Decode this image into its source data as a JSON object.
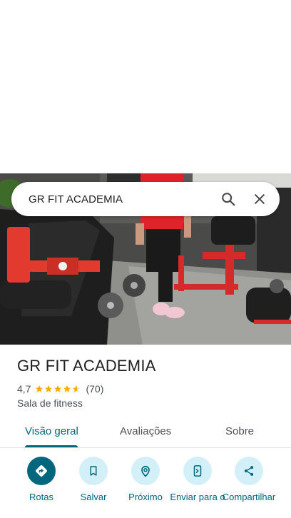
{
  "search": {
    "query": "GR FIT ACADEMIA"
  },
  "icons": {
    "search": "search-icon",
    "close": "close-icon",
    "directions": "directions-icon",
    "bookmark": "bookmark-icon",
    "nearby": "nearby-icon",
    "send": "send-to-phone-icon",
    "share": "share-icon"
  },
  "place": {
    "name": "GR FIT ACADEMIA",
    "rating": "4,7",
    "rating_value": 4.7,
    "review_count": "(70)",
    "category": "Sala de fitness"
  },
  "tabs": [
    {
      "label": "Visão geral",
      "active": true
    },
    {
      "label": "Avaliações",
      "active": false
    },
    {
      "label": "Sobre",
      "active": false
    }
  ],
  "actions": [
    {
      "label": "Rotas"
    },
    {
      "label": "Salvar"
    },
    {
      "label": "Próximo"
    },
    {
      "label": "Enviar para o"
    },
    {
      "label": "Compartilhar"
    }
  ],
  "colors": {
    "accent": "#00677d",
    "action_bg": "#d3f0f8",
    "star": "#f9ab00"
  }
}
